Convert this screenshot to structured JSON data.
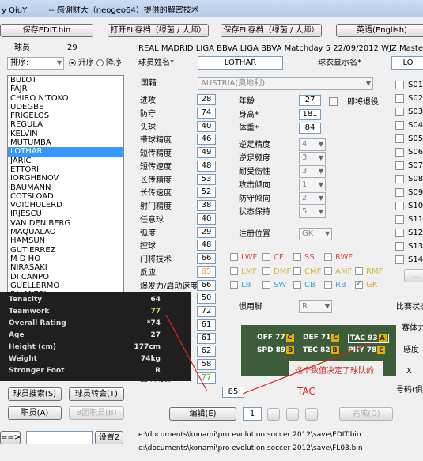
{
  "titlebar": {
    "title": "y QiuY",
    "credits": "-- 感谢财大（neogeo64）提供的解密技术"
  },
  "toolbar": {
    "save_edit": "保存EDIT.bin",
    "open_fl": "打开FL存档（绿茵 / 大师）",
    "save_fl": "保存FL存档（绿茵 / 大师）",
    "language": "英语(English)"
  },
  "filter": {
    "players_label": "球员",
    "players_count": "29",
    "sort_label": "排序:",
    "asc_label": "升序",
    "desc_label": "降序",
    "team_header": "REAL MADRID LIGA BBVA LIGA BBVA Matchday 5  22/09/2012 WJZ Master League"
  },
  "player_list": [
    "BULOT",
    "FAJR",
    "CHIRO N'TOKO",
    "UDEGBE",
    "FRIGELOS",
    "REGULA",
    "KELVIN",
    "MUTUMBA",
    "LOTHAR",
    "JARIC",
    "ETTORI",
    "IORGHENOV",
    "BAUMANN",
    "COTSLOAD",
    "VOICHULERD",
    "IRJESCU",
    "VAN DEN BERG",
    "MAQUALAO",
    "HAMSUN",
    "GUTIERREZ",
    "M D HO",
    "NIRASAKI",
    "DI CANPO",
    "GUELLERMO",
    "PALMIERI"
  ],
  "selected_player": "LOTHAR",
  "player_form": {
    "name_label": "球员姓名*",
    "name_value": "LOTHAR",
    "shirt_label": "球衣显示名*",
    "shirt_value": "LO",
    "nationality_label": "国籍",
    "nationality_value": "AUSTRIA(奥地利)"
  },
  "abilities": [
    {
      "label": "进攻",
      "value": "28"
    },
    {
      "label": "防守",
      "value": "74"
    },
    {
      "label": "头球",
      "value": "40"
    },
    {
      "label": "带球精度",
      "value": "46"
    },
    {
      "label": "短传精度",
      "value": "49"
    },
    {
      "label": "短传速度",
      "value": "48"
    },
    {
      "label": "长传精度",
      "value": "53"
    },
    {
      "label": "长传速度",
      "value": "52"
    },
    {
      "label": "射门精度",
      "value": "38"
    },
    {
      "label": "任意球",
      "value": "40"
    },
    {
      "label": "弧度",
      "value": "29"
    },
    {
      "label": "控球",
      "value": "48"
    },
    {
      "label": "门将技术",
      "value": "66"
    },
    {
      "label": "反应",
      "value": "85"
    },
    {
      "label": "爆发力/启动速度",
      "value": "66"
    },
    {
      "label": "",
      "value": "50"
    },
    {
      "label": "",
      "value": "72"
    },
    {
      "label": "",
      "value": "61"
    },
    {
      "label": "",
      "value": "61"
    },
    {
      "label": "",
      "value": "62"
    },
    {
      "label": "",
      "value": "58"
    },
    {
      "label": "团队配合",
      "value": "77"
    }
  ],
  "teamwork_extra": "85",
  "details": {
    "age_label": "年龄",
    "age": "27",
    "retire_label": "即将退役",
    "height_label": "身高*",
    "height": "181",
    "weight_label": "体重*",
    "weight": "84",
    "weakfoot_acc_label": "逆足精度",
    "weakfoot_acc": "4",
    "weakfoot_freq_label": "逆足频度",
    "weakfoot_freq": "3",
    "injury_label": "耐受伤性",
    "injury": "3",
    "attack_label": "攻击倾向",
    "attack": "1",
    "defense_label": "防守倾向",
    "defense": "2",
    "condition_label": "状态保持",
    "condition": "5",
    "position_label": "注册位置",
    "position": "GK",
    "foot_label": "惯用脚",
    "foot": "R"
  },
  "positions": [
    "LWF",
    "CF",
    "SS",
    "RWF",
    "LMF",
    "DMF",
    "CMF",
    "AMF",
    "RMF",
    "LB",
    "SW",
    "CB",
    "RB",
    "GK"
  ],
  "skills": [
    "S01",
    "S02",
    "S03",
    "S04",
    "S05",
    "S06",
    "S07",
    "S08",
    "S09",
    "S10",
    "S11",
    "S12",
    "S13",
    "S14"
  ],
  "right_panel": {
    "match_label": "比赛状态",
    "team_label": "赛体力",
    "mood_label": "感度",
    "x_label": "X",
    "number_label": "号码(俱"
  },
  "game_overlay": {
    "rows": [
      {
        "label": "Tenacity",
        "value": "64"
      },
      {
        "label": "Teamwork",
        "value": "77"
      },
      {
        "label": "Overall Rating",
        "value": "*74"
      },
      {
        "label": "Age",
        "value": "27"
      },
      {
        "label": "Height (cm)",
        "value": "177cm"
      },
      {
        "label": "Weight",
        "value": "74kg"
      },
      {
        "label": "Stronger Foot",
        "value": "R"
      }
    ]
  },
  "team_overlay": {
    "off": "OFF 77",
    "off_b": "C",
    "def": "DEF 71",
    "def_b": "C",
    "tac": "TAC 93",
    "tac_b": "A",
    "spd": "SPD 89",
    "spd_b": "B",
    "tec": "TEC 82",
    "tec_b": "B",
    "phy": "PHY 78",
    "phy_b": "C"
  },
  "annotation": {
    "line1": "这个数值决定了球队的",
    "line2": "TAC"
  },
  "bottom": {
    "search_btn": "球员搜索(S)",
    "transfer_btn": "球员转会(T)",
    "job_btn": "职员(A)",
    "ball_btn": "B团职员(B)",
    "edit_btn": "编辑(E)",
    "page_num": "1",
    "done_btn": "完成(D)",
    "goto_btn": "==>",
    "settings_btn": "设置2",
    "path1": "e:\\documents\\konami\\pro evolution soccer 2012\\save\\EDIT.bin",
    "path2": "e:\\documents\\konami\\pro evolution soccer 2012\\save\\FL03.bin"
  },
  "colors": {
    "accent": "#3399ff",
    "highlight_orange": "#f0a040",
    "highlight_green": "#5aa02c",
    "annotation_red": "#e02020"
  }
}
